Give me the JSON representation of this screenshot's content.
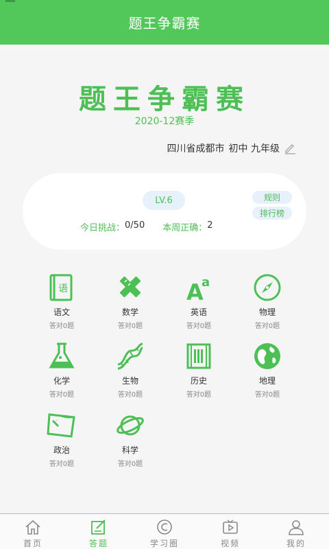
{
  "header": {
    "title": "题王争霸赛"
  },
  "hero": {
    "title": "题王争霸赛",
    "season": "2020-12赛季"
  },
  "user": {
    "location": "四川省成都市",
    "grade": "初中 九年级"
  },
  "card": {
    "level": "LV.6",
    "rules_label": "规则",
    "rank_label": "排行榜",
    "today_label": "今日挑战：",
    "today_value": "0/50",
    "week_label": "本周正确：",
    "week_value": "2"
  },
  "subjects": [
    {
      "name": "语文",
      "score": "答对0题",
      "icon": "book-icon"
    },
    {
      "name": "数学",
      "score": "答对0题",
      "icon": "ruler-pencil-icon"
    },
    {
      "name": "英语",
      "score": "答对0题",
      "icon": "letters-icon"
    },
    {
      "name": "物理",
      "score": "答对0题",
      "icon": "compass-icon"
    },
    {
      "name": "化学",
      "score": "答对0题",
      "icon": "flask-icon"
    },
    {
      "name": "生物",
      "score": "答对0题",
      "icon": "dna-icon"
    },
    {
      "name": "历史",
      "score": "答对0题",
      "icon": "scroll-icon"
    },
    {
      "name": "地理",
      "score": "答对0题",
      "icon": "globe-icon"
    },
    {
      "name": "政治",
      "score": "答对0题",
      "icon": "flag-icon"
    },
    {
      "name": "科学",
      "score": "答对0题",
      "icon": "planet-icon"
    }
  ],
  "tabs": [
    {
      "label": "首页",
      "icon": "home-icon"
    },
    {
      "label": "答题",
      "icon": "answer-icon",
      "active": true
    },
    {
      "label": "学习圈",
      "icon": "circle-icon"
    },
    {
      "label": "视频",
      "icon": "tv-icon"
    },
    {
      "label": "我的",
      "icon": "user-icon"
    }
  ],
  "colors": {
    "accent": "#52c85b",
    "pill_bg": "#e6f1fb"
  }
}
